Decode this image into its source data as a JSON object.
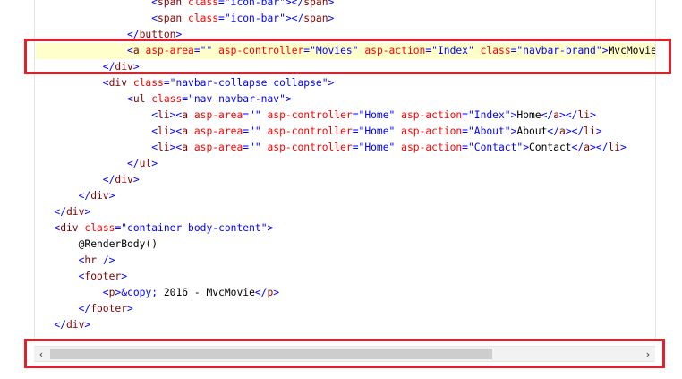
{
  "editor": {
    "lines": [
      {
        "parts": [
          [
            "punct",
            "<"
          ],
          [
            "tag",
            "span"
          ],
          [
            "text",
            " "
          ],
          [
            "attr",
            "class"
          ],
          [
            "punct",
            "=\""
          ],
          [
            "val",
            "icon-bar"
          ],
          [
            "punct",
            "\"></"
          ],
          [
            "tag",
            "span"
          ],
          [
            "punct",
            ">"
          ]
        ],
        "indent": 19
      },
      {
        "parts": [
          [
            "punct",
            "<"
          ],
          [
            "tag",
            "span"
          ],
          [
            "text",
            " "
          ],
          [
            "attr",
            "class"
          ],
          [
            "punct",
            "=\""
          ],
          [
            "val",
            "icon-bar"
          ],
          [
            "punct",
            "\"></"
          ],
          [
            "tag",
            "span"
          ],
          [
            "punct",
            ">"
          ]
        ],
        "indent": 19
      },
      {
        "parts": [
          [
            "punct",
            "</"
          ],
          [
            "tag",
            "button"
          ],
          [
            "punct",
            ">"
          ]
        ],
        "indent": 15
      },
      {
        "parts": [
          [
            "punct",
            "<"
          ],
          [
            "tag",
            "a"
          ],
          [
            "text",
            " "
          ],
          [
            "attr",
            "asp-area"
          ],
          [
            "punct",
            "=\"\""
          ],
          [
            "text",
            " "
          ],
          [
            "attr",
            "asp-controller"
          ],
          [
            "punct",
            "=\""
          ],
          [
            "val",
            "Movies"
          ],
          [
            "punct",
            "\""
          ],
          [
            "text",
            " "
          ],
          [
            "attr",
            "asp-action"
          ],
          [
            "punct",
            "=\""
          ],
          [
            "val",
            "Index"
          ],
          [
            "punct",
            "\""
          ],
          [
            "text",
            " "
          ],
          [
            "attr",
            "class"
          ],
          [
            "punct",
            "=\""
          ],
          [
            "val",
            "navbar-brand"
          ],
          [
            "punct",
            "\">"
          ],
          [
            "text",
            "MvcMovie"
          ]
        ],
        "indent": 15,
        "highlight": true
      },
      {
        "parts": [
          [
            "punct",
            "</"
          ],
          [
            "tag",
            "div"
          ],
          [
            "punct",
            ">"
          ]
        ],
        "indent": 11
      },
      {
        "parts": [
          [
            "punct",
            "<"
          ],
          [
            "tag",
            "div"
          ],
          [
            "text",
            " "
          ],
          [
            "attr",
            "class"
          ],
          [
            "punct",
            "=\""
          ],
          [
            "val",
            "navbar-collapse collapse"
          ],
          [
            "punct",
            "\">"
          ]
        ],
        "indent": 11
      },
      {
        "parts": [
          [
            "punct",
            "<"
          ],
          [
            "tag",
            "ul"
          ],
          [
            "text",
            " "
          ],
          [
            "attr",
            "class"
          ],
          [
            "punct",
            "=\""
          ],
          [
            "val",
            "nav navbar-nav"
          ],
          [
            "punct",
            "\">"
          ]
        ],
        "indent": 15
      },
      {
        "parts": [
          [
            "punct",
            "<"
          ],
          [
            "tag",
            "li"
          ],
          [
            "punct",
            "><"
          ],
          [
            "tag",
            "a"
          ],
          [
            "text",
            " "
          ],
          [
            "attr",
            "asp-area"
          ],
          [
            "punct",
            "=\"\""
          ],
          [
            "text",
            " "
          ],
          [
            "attr",
            "asp-controller"
          ],
          [
            "punct",
            "=\""
          ],
          [
            "val",
            "Home"
          ],
          [
            "punct",
            "\""
          ],
          [
            "text",
            " "
          ],
          [
            "attr",
            "asp-action"
          ],
          [
            "punct",
            "=\""
          ],
          [
            "val",
            "Index"
          ],
          [
            "punct",
            "\">"
          ],
          [
            "text",
            "Home"
          ],
          [
            "punct",
            "</"
          ],
          [
            "tag",
            "a"
          ],
          [
            "punct",
            "></"
          ],
          [
            "tag",
            "li"
          ],
          [
            "punct",
            ">"
          ]
        ],
        "indent": 19
      },
      {
        "parts": [
          [
            "punct",
            "<"
          ],
          [
            "tag",
            "li"
          ],
          [
            "punct",
            "><"
          ],
          [
            "tag",
            "a"
          ],
          [
            "text",
            " "
          ],
          [
            "attr",
            "asp-area"
          ],
          [
            "punct",
            "=\"\""
          ],
          [
            "text",
            " "
          ],
          [
            "attr",
            "asp-controller"
          ],
          [
            "punct",
            "=\""
          ],
          [
            "val",
            "Home"
          ],
          [
            "punct",
            "\""
          ],
          [
            "text",
            " "
          ],
          [
            "attr",
            "asp-action"
          ],
          [
            "punct",
            "=\""
          ],
          [
            "val",
            "About"
          ],
          [
            "punct",
            "\">"
          ],
          [
            "text",
            "About"
          ],
          [
            "punct",
            "</"
          ],
          [
            "tag",
            "a"
          ],
          [
            "punct",
            "></"
          ],
          [
            "tag",
            "li"
          ],
          [
            "punct",
            ">"
          ]
        ],
        "indent": 19
      },
      {
        "parts": [
          [
            "punct",
            "<"
          ],
          [
            "tag",
            "li"
          ],
          [
            "punct",
            "><"
          ],
          [
            "tag",
            "a"
          ],
          [
            "text",
            " "
          ],
          [
            "attr",
            "asp-area"
          ],
          [
            "punct",
            "=\"\""
          ],
          [
            "text",
            " "
          ],
          [
            "attr",
            "asp-controller"
          ],
          [
            "punct",
            "=\""
          ],
          [
            "val",
            "Home"
          ],
          [
            "punct",
            "\""
          ],
          [
            "text",
            " "
          ],
          [
            "attr",
            "asp-action"
          ],
          [
            "punct",
            "=\""
          ],
          [
            "val",
            "Contact"
          ],
          [
            "punct",
            "\">"
          ],
          [
            "text",
            "Contact"
          ],
          [
            "punct",
            "</"
          ],
          [
            "tag",
            "a"
          ],
          [
            "punct",
            "></"
          ],
          [
            "tag",
            "li"
          ],
          [
            "punct",
            ">"
          ]
        ],
        "indent": 19
      },
      {
        "parts": [
          [
            "punct",
            "</"
          ],
          [
            "tag",
            "ul"
          ],
          [
            "punct",
            ">"
          ]
        ],
        "indent": 15
      },
      {
        "parts": [
          [
            "punct",
            "</"
          ],
          [
            "tag",
            "div"
          ],
          [
            "punct",
            ">"
          ]
        ],
        "indent": 11
      },
      {
        "parts": [
          [
            "punct",
            "</"
          ],
          [
            "tag",
            "div"
          ],
          [
            "punct",
            ">"
          ]
        ],
        "indent": 7
      },
      {
        "parts": [
          [
            "punct",
            "</"
          ],
          [
            "tag",
            "div"
          ],
          [
            "punct",
            ">"
          ]
        ],
        "indent": 3
      },
      {
        "parts": [
          [
            "punct",
            "<"
          ],
          [
            "tag",
            "div"
          ],
          [
            "text",
            " "
          ],
          [
            "attr",
            "class"
          ],
          [
            "punct",
            "=\""
          ],
          [
            "val",
            "container body-content"
          ],
          [
            "punct",
            "\">"
          ]
        ],
        "indent": 3
      },
      {
        "parts": [
          [
            "razor",
            "@RenderBody()"
          ]
        ],
        "indent": 7
      },
      {
        "parts": [
          [
            "punct",
            "<"
          ],
          [
            "tag",
            "hr"
          ],
          [
            "text",
            " "
          ],
          [
            "punct",
            "/>"
          ]
        ],
        "indent": 7
      },
      {
        "parts": [
          [
            "punct",
            "<"
          ],
          [
            "tag",
            "footer"
          ],
          [
            "punct",
            ">"
          ]
        ],
        "indent": 7
      },
      {
        "parts": [
          [
            "punct",
            "<"
          ],
          [
            "tag",
            "p"
          ],
          [
            "punct",
            ">"
          ],
          [
            "val",
            "&copy;"
          ],
          [
            "text",
            " 2016 - MvcMovie"
          ],
          [
            "punct",
            "</"
          ],
          [
            "tag",
            "p"
          ],
          [
            "punct",
            ">"
          ]
        ],
        "indent": 11
      },
      {
        "parts": [
          [
            "punct",
            "</"
          ],
          [
            "tag",
            "footer"
          ],
          [
            "punct",
            ">"
          ]
        ],
        "indent": 7
      },
      {
        "parts": [
          [
            "punct",
            "</"
          ],
          [
            "tag",
            "div"
          ],
          [
            "punct",
            ">"
          ]
        ],
        "indent": 3
      }
    ]
  },
  "scrollbar": {
    "left_arrow": "‹",
    "right_arrow": "›",
    "thumb_fraction": 0.75
  },
  "colors": {
    "tag": "#800000",
    "attribute": "#ff0000",
    "value": "#0000ff",
    "callout": "#e0212c",
    "line_highlight": "#ffffcc"
  }
}
